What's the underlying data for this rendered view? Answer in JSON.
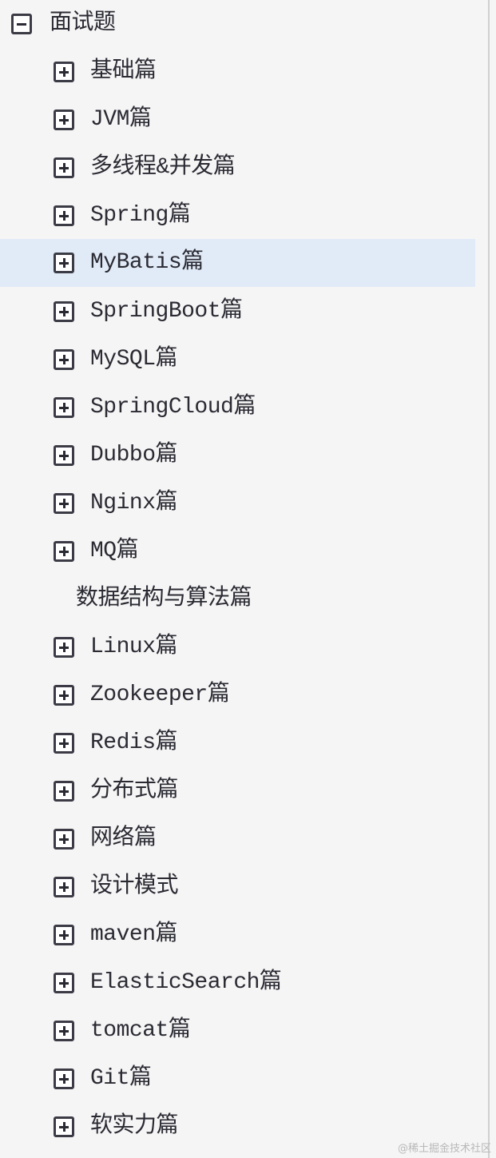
{
  "tree": {
    "root_label": "面试题",
    "items": [
      {
        "label": "基础篇"
      },
      {
        "label": "JVM篇"
      },
      {
        "label": "多线程&并发篇"
      },
      {
        "label": "Spring篇"
      },
      {
        "label": "MyBatis篇"
      },
      {
        "label": "SpringBoot篇"
      },
      {
        "label": "MySQL篇"
      },
      {
        "label": "SpringCloud篇"
      },
      {
        "label": "Dubbo篇"
      },
      {
        "label": "Nginx篇"
      },
      {
        "label": "MQ篇"
      },
      {
        "label": "数据结构与算法篇"
      },
      {
        "label": "Linux篇"
      },
      {
        "label": "Zookeeper篇"
      },
      {
        "label": "Redis篇"
      },
      {
        "label": "分布式篇"
      },
      {
        "label": "网络篇"
      },
      {
        "label": "设计模式"
      },
      {
        "label": "maven篇"
      },
      {
        "label": "ElasticSearch篇"
      },
      {
        "label": "tomcat篇"
      },
      {
        "label": "Git篇"
      },
      {
        "label": "软实力篇"
      }
    ],
    "selected_label": "MyBatis篇"
  },
  "watermark": "@稀土掘金技术社区",
  "colors": {
    "background": "#f5f5f5",
    "selected_row": "#e1ebf7",
    "text": "#2a2a33",
    "icon_border": "#3b3b46"
  },
  "icons": {
    "collapse": "minus-square-icon",
    "expand": "plus-square-icon"
  }
}
